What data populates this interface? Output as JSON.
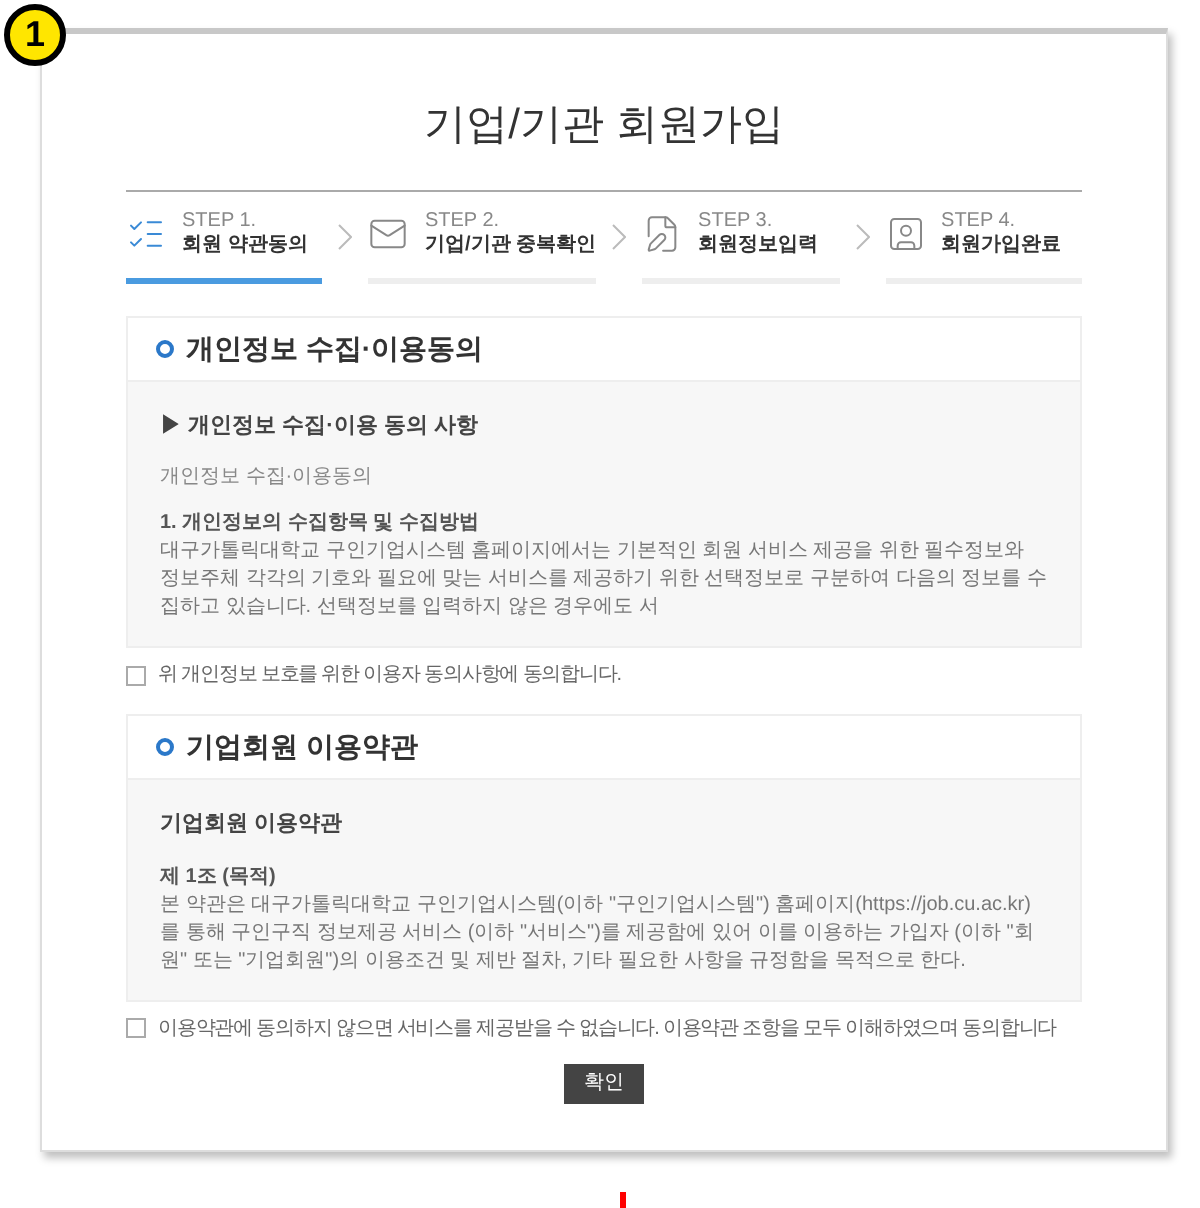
{
  "badge": "1",
  "title": "기업/기관 회원가입",
  "steps": [
    {
      "kind": "terms",
      "step": "STEP 1.",
      "label": "회원 약관동의",
      "selected": true
    },
    {
      "kind": "verify",
      "step": "STEP 2.",
      "label": "기업/기관 중복확인",
      "selected": false
    },
    {
      "kind": "form",
      "step": "STEP 3.",
      "label": "회원정보입력",
      "selected": false
    },
    {
      "kind": "done",
      "step": "STEP 4.",
      "label": "회원가입완료",
      "selected": false
    }
  ],
  "sections": [
    {
      "heading": "개인정보 수집·이용동의",
      "subheading": "▶ 개인정보 수집·이용 동의 사항",
      "intro": "개인정보 수집·이용동의",
      "article": "1. 개인정보의 수집항목 및 수집방법",
      "body": "대구가톨릭대학교 구인기업시스템 홈페이지에서는 기본적인 회원 서비스 제공을 위한 필수정보와 정보주체 각각의 기호와 필요에 맞는 서비스를 제공하기 위한 선택정보로 구분하여 다음의 정보를 수집하고 있습니다. 선택정보를 입력하지 않은 경우에도 서",
      "agree": {
        "label": "위 개인정보 보호를 위한 이용자 동의사항에 동의합니다.",
        "checked": false
      }
    },
    {
      "heading": "기업회원 이용약관",
      "subheading": "기업회원 이용약관",
      "article": "제 1조 (목적)",
      "body": "본 약관은 대구가톨릭대학교 구인기업시스템(이하 \"구인기업시스템\") 홈페이지(https://job.cu.ac.kr)를 통해 구인구직 정보제공 서비스 (이하 \"서비스\")를 제공함에 있어 이를 이용하는 가입자 (이하 \"회원\" 또는 \"기업회원\")의 이용조건 및 제반 절차, 기타 필요한 사항을 규정함을 목적으로 한다.",
      "agree": {
        "label": "이용약관에 동의하지 않으면 서비스를 제공받을 수 없습니다. 이용약관 조항을 모두 이해하였으며 동의합니다",
        "checked": false
      }
    }
  ],
  "confirm_button": "확인"
}
